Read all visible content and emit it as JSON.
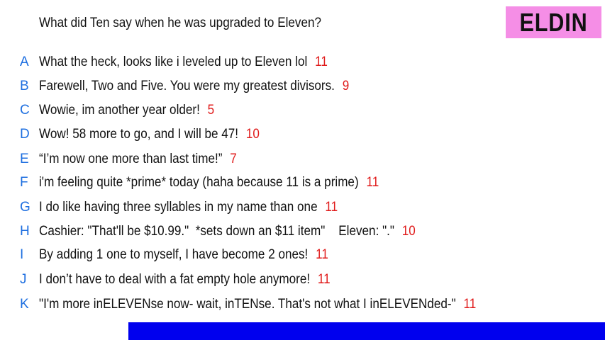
{
  "question": "What did Ten say when he was upgraded to Eleven?",
  "badge": "ELDIN",
  "colors": {
    "letter": "#1e6fe0",
    "score": "#e01b1b",
    "badge_bg": "#f58ee6",
    "bar": "#0000ee"
  },
  "answers": [
    {
      "letter": "A",
      "text": "What the heck, looks like i leveled up to Eleven lol",
      "score": "11"
    },
    {
      "letter": "B",
      "text": "Farewell, Two and Five. You were my greatest divisors.",
      "score": "9"
    },
    {
      "letter": "C",
      "text": "Wowie, im another year older!",
      "score": "5"
    },
    {
      "letter": "D",
      "text": "Wow! 58 more to go, and I will be 47!",
      "score": "10"
    },
    {
      "letter": "E",
      "text": "“I’m now one more than last time!”",
      "score": "7"
    },
    {
      "letter": "F",
      "text": "i'm feeling quite *prime* today (haha because 11 is a prime)",
      "score": "11"
    },
    {
      "letter": "G",
      "text": "I do like having three syllables in my name than one",
      "score": "11"
    },
    {
      "letter": "H",
      "text": "Cashier: \"That'll be $10.99.\"  *sets down an $11 item\"    Eleven: \".\"",
      "score": "10"
    },
    {
      "letter": "I",
      "text": "By adding 1 one to myself, I have become 2 ones!",
      "score": "11"
    },
    {
      "letter": "J",
      "text": "I don’t have to deal with a fat empty hole anymore!",
      "score": "11"
    },
    {
      "letter": "K",
      "text": "\"I'm more inELEVENse now- wait, inTENse. That's not what I inELEVENded-\"",
      "score": "11"
    }
  ]
}
